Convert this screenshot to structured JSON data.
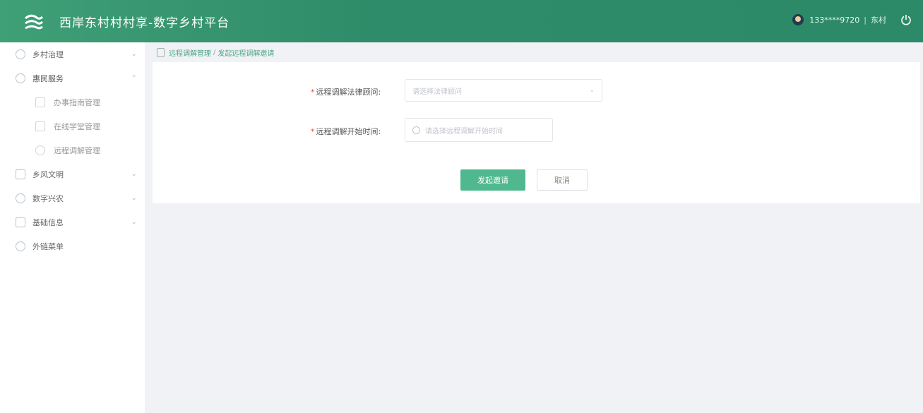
{
  "header": {
    "title": "西岸东村村村享-数字乡村平台",
    "user_phone": "133****9720",
    "separator": "|",
    "user_village": "东村"
  },
  "breadcrumb": {
    "parent": "远程调解管理",
    "separator": "/",
    "current": "发起远程调解邀请"
  },
  "sidebar": {
    "items": [
      {
        "label": "乡村治理",
        "icon": "governance-icon",
        "expanded": false
      },
      {
        "label": "惠民服务",
        "icon": "service-icon",
        "expanded": true,
        "children": [
          {
            "label": "办事指南管理",
            "icon": "guide-icon"
          },
          {
            "label": "在线学堂管理",
            "icon": "classroom-icon"
          },
          {
            "label": "远程调解管理",
            "icon": "mediation-icon"
          }
        ]
      },
      {
        "label": "乡风文明",
        "icon": "civilization-icon",
        "expanded": false
      },
      {
        "label": "数字兴农",
        "icon": "agriculture-icon",
        "expanded": false
      },
      {
        "label": "基础信息",
        "icon": "info-icon",
        "expanded": false
      },
      {
        "label": "外链菜单",
        "icon": "link-icon",
        "expanded": false
      }
    ]
  },
  "form": {
    "lawyer_label": "远程调解法律顾问:",
    "lawyer_placeholder": "请选择法律顾问",
    "time_label": "远程调解开始时间:",
    "time_placeholder": "请选择远程调解开始时间",
    "submit_label": "发起邀请",
    "cancel_label": "取消"
  },
  "colors": {
    "header_green": "#2f8c6a",
    "primary_button": "#4fb88e",
    "breadcrumb_link": "#4aa584"
  }
}
